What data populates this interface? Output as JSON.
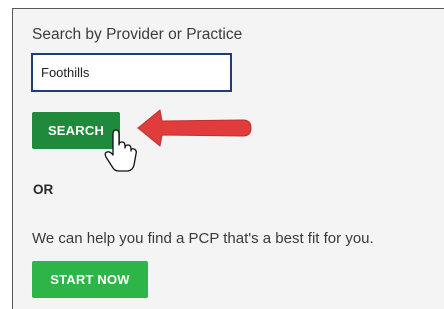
{
  "search": {
    "label": "Search by Provider or Practice",
    "value": "Foothills",
    "button_label": "SEARCH"
  },
  "divider_label": "OR",
  "guided": {
    "prompt": "We can help you find a PCP that's a best fit for you.",
    "button_label": "START NOW"
  },
  "colors": {
    "search_button": "#1f8a3c",
    "start_button": "#2db547",
    "input_border": "#1f3f73",
    "arrow": "#e03c3c"
  },
  "icons": {
    "annotation_arrow": "left-arrow-icon",
    "cursor": "hand-pointer-icon"
  }
}
